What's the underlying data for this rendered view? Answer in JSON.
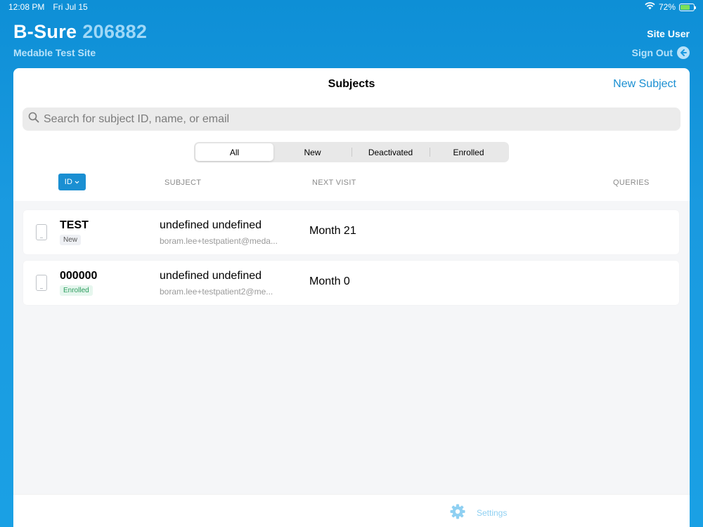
{
  "status": {
    "time": "12:08 PM",
    "date": "Fri Jul 15",
    "battery": "72%"
  },
  "app": {
    "name": "B-Sure",
    "study_id": "206882",
    "site": "Medable Test Site",
    "user": "Site User",
    "sign_out": "Sign Out"
  },
  "panel": {
    "title": "Subjects",
    "new_subject": "New Subject",
    "search_placeholder": "Search for subject ID, name, or email"
  },
  "filters": [
    "All",
    "New",
    "Deactivated",
    "Enrolled"
  ],
  "columns": {
    "id": "ID",
    "subject": "SUBJECT",
    "next_visit": "NEXT VISIT",
    "queries": "QUERIES"
  },
  "subjects": [
    {
      "id": "TEST",
      "status": "New",
      "name": "undefined undefined",
      "email": "boram.lee+testpatient@meda...",
      "next_visit": "Month 21"
    },
    {
      "id": "000000",
      "status": "Enrolled",
      "name": "undefined undefined",
      "email": "boram.lee+testpatient2@me...",
      "next_visit": "Month 0"
    }
  ],
  "footer": {
    "settings": "Settings"
  }
}
